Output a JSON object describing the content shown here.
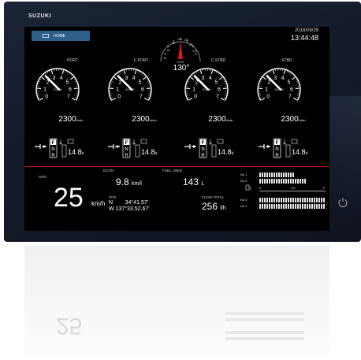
{
  "brand": "SUZUKI",
  "header": {
    "home_label": "HOME",
    "date": "2018/09/29",
    "time": "13:44:48"
  },
  "compass": {
    "cog_label": "COG",
    "heading": "130°",
    "ticks": [
      "0",
      "90",
      "120",
      "150",
      "180",
      "210",
      "30",
      "60"
    ]
  },
  "gauges": [
    {
      "label": "PORT",
      "rpm": "2300",
      "unit": "r/min",
      "multiplier": "X1000",
      "needle_fraction": 0.33
    },
    {
      "label": "C.PORT",
      "rpm": "2300",
      "unit": "r/min",
      "multiplier": "X1000",
      "needle_fraction": 0.33
    },
    {
      "label": "C.STBD",
      "rpm": "2300",
      "unit": "r/min",
      "multiplier": "X1000",
      "needle_fraction": 0.33
    },
    {
      "label": "STBD",
      "rpm": "2300",
      "unit": "r/min",
      "multiplier": "X1000",
      "needle_fraction": 0.33
    }
  ],
  "gauge_scale": [
    "0",
    "1",
    "2",
    "3",
    "4",
    "5",
    "6",
    "7"
  ],
  "engines": [
    {
      "gear": [
        "F",
        "N",
        "R"
      ],
      "voltage": "14.8",
      "voltage_unit": "v"
    },
    {
      "gear": [
        "F",
        "N",
        "R"
      ],
      "voltage": "14.8",
      "voltage_unit": "v"
    },
    {
      "gear": [
        "F",
        "N",
        "R"
      ],
      "voltage": "14.8",
      "voltage_unit": "v"
    },
    {
      "gear": [
        "F",
        "N",
        "R"
      ],
      "voltage": "14.8",
      "voltage_unit": "v"
    }
  ],
  "bottom": {
    "sog_label": "SOG",
    "sog_value": "25",
    "sog_unit": "km/h",
    "econ_label": "ECON",
    "econ_value": "9.8",
    "econ_unit": "km/l",
    "fuel_used_label": "FUEL USED",
    "fuel_used_value": "143",
    "fuel_used_unit": "L",
    "pos_label": "POS",
    "lat_hemi": "N",
    "lat": "34°41.57'",
    "lon_hemi": "W",
    "lon": "137°33.52.67'",
    "flow_total_label": "FLOW TOTAL",
    "flow_total_value": "256",
    "flow_total_unit": "l/h"
  },
  "tanks": {
    "rows": [
      "No.1",
      "No.2",
      "No.3",
      "No.4"
    ],
    "levels": [
      0.55,
      0.7,
      1.0,
      1.0
    ],
    "scale": [
      "E",
      "1/2",
      "F"
    ]
  }
}
